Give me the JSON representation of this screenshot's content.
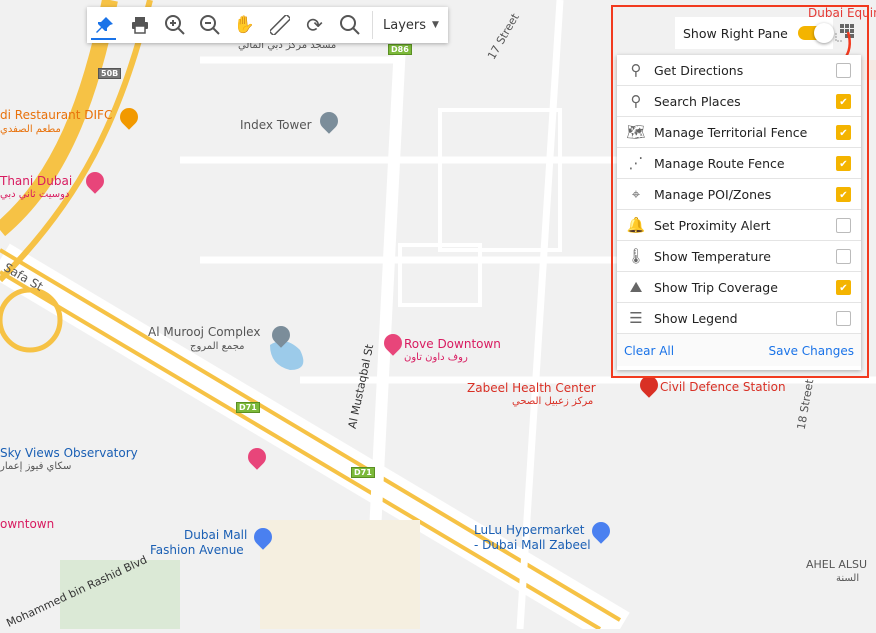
{
  "toolbar": {
    "tools": [
      "pin-icon",
      "print-icon",
      "zoom-in-icon",
      "zoom-out-icon",
      "pan-hand-icon",
      "ruler-icon",
      "refresh-icon",
      "search-icon"
    ],
    "active_tool": "pin-icon",
    "layers_label": "Layers"
  },
  "right_pane": {
    "toggle_label": "Show Right Pane",
    "toggle_on": true,
    "accent": "#f4b400",
    "highlight": "#f23a1f"
  },
  "menu": {
    "items": [
      {
        "label": "Get Directions",
        "icon": "directions-pin-icon",
        "checked": false
      },
      {
        "label": "Search Places",
        "icon": "place-pin-icon",
        "checked": true
      },
      {
        "label": "Manage Territorial Fence",
        "icon": "territory-map-icon",
        "checked": true
      },
      {
        "label": "Manage Route Fence",
        "icon": "route-fence-icon",
        "checked": true
      },
      {
        "label": "Manage POI/Zones",
        "icon": "crosshair-icon",
        "checked": true
      },
      {
        "label": "Set Proximity Alert",
        "icon": "bell-icon",
        "checked": false
      },
      {
        "label": "Show Temperature",
        "icon": "thermometer-icon",
        "checked": false
      },
      {
        "label": "Show Trip Coverage",
        "icon": "map-pin-icon",
        "checked": true
      },
      {
        "label": "Show Legend",
        "icon": "list-icon",
        "checked": false
      }
    ],
    "clear_all": "Clear All",
    "save_changes": "Save Changes"
  },
  "map": {
    "labels": {
      "dubai_equine": "Dubai Equine",
      "mosque_ar": "مسجد مركز دبي المالي",
      "d86": "D86",
      "street17": "17 Street",
      "b50": "50B",
      "restaurant": "di Restaurant DIFC",
      "restaurant_ar": "مطعم الصفدي",
      "index_tower": "Index Tower",
      "thani": "Thani Dubai",
      "thani_ar": "دوسيت ثاني دبي",
      "safa": "Safa St",
      "murooj": "Al Murooj Complex",
      "murooj_ar": "مجمع المروج",
      "rove": "Rove Downtown",
      "rove_ar": "روف داون تاون",
      "mustaqbal": "Al Mustaqbal St",
      "zabeel": "Zabeel Health Center",
      "zabeel_ar": "مركز زعبيل الصحي",
      "civil": "Civil Defence Station",
      "street18": "18 Street",
      "d71": "D71",
      "sky": "Sky Views Observatory",
      "sky_ar": "سكاي فيوز إعمار",
      "downtown": "owntown",
      "mall1": "Dubai Mall",
      "mall2": "Fashion Avenue",
      "lulu1": "LuLu Hypermarket",
      "lulu2": "- Dubai Mall Zabeel",
      "ahel": "AHEL ALSU",
      "ahel_ar": "السنة",
      "mbr": "Mohammed bin Rashid Blvd"
    }
  }
}
